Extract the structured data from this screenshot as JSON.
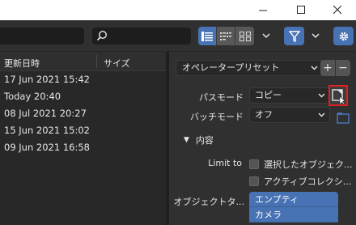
{
  "window": {
    "minimize_glyph": "—",
    "maximize_glyph": "☐",
    "close_glyph": "✕"
  },
  "colors": {
    "accent": "#4772b3",
    "highlight_box": "#e02020",
    "panel_bg": "#303030",
    "list_bg": "#282828"
  },
  "toolbar": {
    "path_value": "",
    "search_value": "",
    "view_modes": [
      "vertical-list-icon",
      "horizontal-list-icon",
      "thumbnails-icon"
    ],
    "icons": [
      "search-icon",
      "filter-icon",
      "gear-icon",
      "chevron-down-icon"
    ]
  },
  "file_list": {
    "columns": [
      "更新日時",
      "サイズ"
    ],
    "rows": [
      "17 Jun 2021 15:42",
      "Today 20:40",
      "08 Jul 2021 20:27",
      "15 Jun 2021 15:02",
      "09 Jun 2021 16:58"
    ]
  },
  "panel": {
    "preset_label": "オペレータープリセット",
    "plus_label": "+",
    "minus_label": "−",
    "path_mode_label": "パスモード",
    "path_mode_value": "コピー",
    "batch_mode_label": "バッチモード",
    "batch_mode_value": "オフ",
    "section_title": "内容",
    "section_arrow": "▼",
    "limit_label": "Limit to",
    "limit_options": [
      "選択したオブジェク...",
      "アクティブコレクシ..."
    ],
    "object_type_label": "オブジェクトタ...",
    "object_types": [
      "エンプティ",
      "カメラ"
    ]
  }
}
